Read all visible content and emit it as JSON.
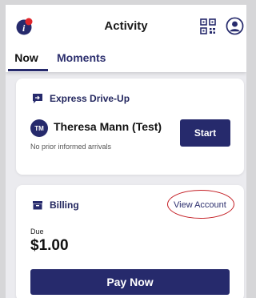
{
  "header": {
    "title": "Activity",
    "tabs": [
      {
        "label": "Now",
        "active": true
      },
      {
        "label": "Moments",
        "active": false
      }
    ],
    "icons": [
      "app-logo-icon",
      "qr-code-icon",
      "profile-icon"
    ]
  },
  "drive_up": {
    "title": "Express Drive-Up",
    "icon": "drive-up-icon",
    "avatar_initials": "TM",
    "name": "Theresa Mann (Test)",
    "subtitle": "No prior informed arrivals",
    "start_label": "Start"
  },
  "billing": {
    "title": "Billing",
    "icon": "billing-icon",
    "view_account_label": "View Account",
    "due_label": "Due",
    "due_amount": "$1.00",
    "pay_label": "Pay Now"
  },
  "colors": {
    "primary": "#262a6c",
    "highlight_circle": "#c41e24",
    "logo_accent": "#e0262b"
  }
}
